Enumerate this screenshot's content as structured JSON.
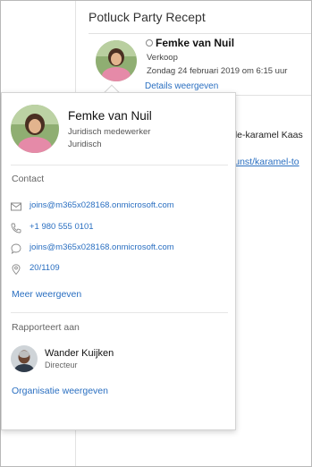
{
  "message": {
    "subject": "Potluck Party Recept",
    "sender_name": "Femke van Nuil",
    "sender_department": "Verkoop",
    "sent_date": "Zondag 24 februari 2019 om 6:15 uur",
    "details_link": "Details weergeven",
    "body_text": "ple-karamel Kaas",
    "body_link": "kunst/karamel-to"
  },
  "card": {
    "name": "Femke van Nuil",
    "job_title": "Juridisch medewerker",
    "department": "Juridisch",
    "contact_heading": "Contact",
    "contact_items": [
      {
        "icon": "mail-icon",
        "value": "joins@m365x028168.onmicrosoft.com"
      },
      {
        "icon": "phone-icon",
        "value": "+1 980 555 0101"
      },
      {
        "icon": "chat-icon",
        "value": "joins@m365x028168.onmicrosoft.com"
      },
      {
        "icon": "location-icon",
        "value": "20/1109"
      }
    ],
    "show_more": "Meer weergeven",
    "reports_heading": "Rapporteert aan",
    "manager_name": "Wander Kuijken",
    "manager_title": "Directeur",
    "org_link": "Organisatie weergeven"
  },
  "colors": {
    "link": "#2a6fc1",
    "muted_text": "#666666",
    "divider": "#e6e6e6"
  }
}
